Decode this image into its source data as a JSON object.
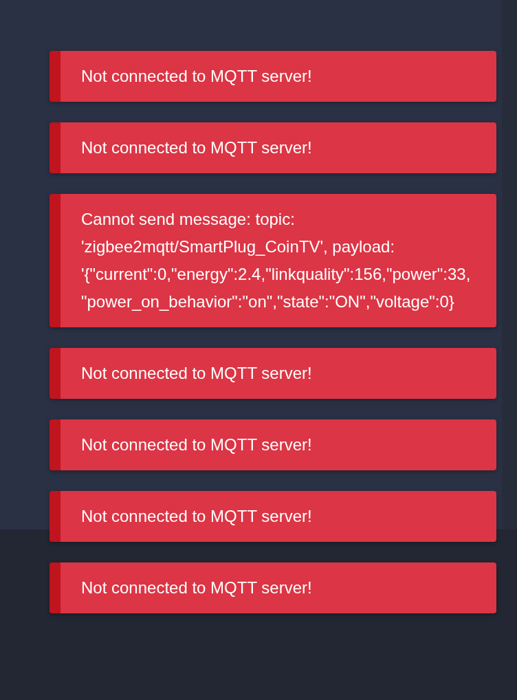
{
  "toasts": [
    {
      "kind": "error",
      "message": "Not connected to MQTT server!"
    },
    {
      "kind": "error",
      "message": "Not connected to MQTT server!"
    },
    {
      "kind": "error",
      "message": "Cannot send message: topic: 'zigbee2mqtt/SmartPlug_CoinTV', payload: '{\"current\":0,\"energy\":2.4,\"linkquality\":156,\"power\":33,\"power_on_behavior\":\"on\",\"state\":\"ON\",\"voltage\":0}"
    },
    {
      "kind": "error",
      "message": "Not connected to MQTT server!"
    },
    {
      "kind": "error",
      "message": "Not connected to MQTT server!"
    },
    {
      "kind": "error",
      "message": "Not connected to MQTT server!"
    },
    {
      "kind": "error",
      "message": "Not connected to MQTT server!"
    }
  ]
}
